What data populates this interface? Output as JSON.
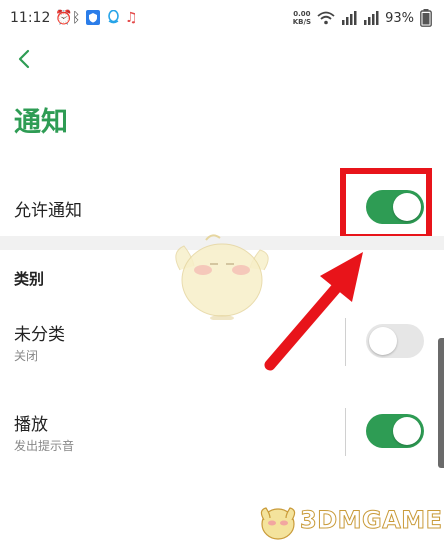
{
  "status_bar": {
    "time": "11:12",
    "net_speed_value": "0.00",
    "net_speed_unit": "KB/S",
    "battery": "93%"
  },
  "page": {
    "title": "通知"
  },
  "allow_notifications": {
    "label": "允许通知",
    "enabled": true
  },
  "category_section": {
    "title": "类别",
    "items": [
      {
        "label": "未分类",
        "status": "关闭",
        "enabled": false
      },
      {
        "label": "播放",
        "status": "发出提示音",
        "enabled": true
      }
    ]
  },
  "watermark": {
    "text": "3DMGAME"
  },
  "colors": {
    "accent": "#2e9c54",
    "highlight": "#e8141a",
    "toggle_off": "#e6e6e6"
  }
}
